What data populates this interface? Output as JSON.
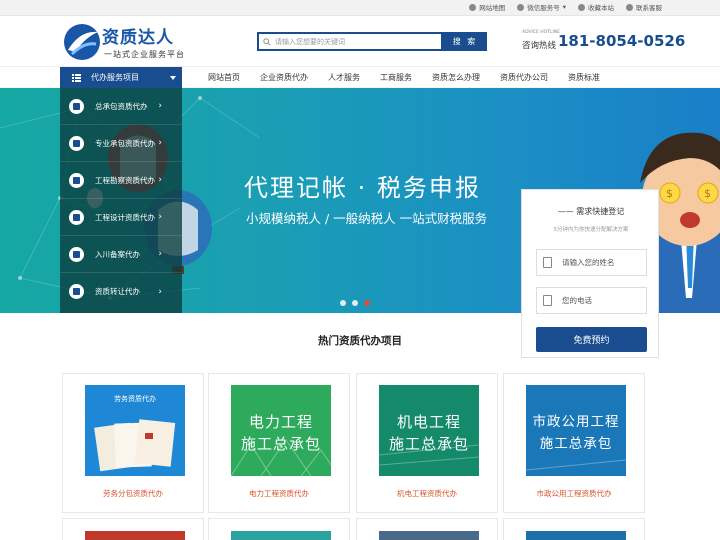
{
  "topbar": {
    "links": [
      "网站地图",
      "微信服务号",
      "收藏本站",
      "联系客服"
    ]
  },
  "header": {
    "logo_name": "资质达人",
    "logo_slogan": "一站式企业服务平台",
    "search_placeholder": "请输入您想要的关键词",
    "search_button": "搜 索",
    "hotline_en": "ADVICE HOTLINE",
    "hotline_label": "咨询热线",
    "hotline_number": "181-8054-0526"
  },
  "nav": {
    "category_label": "代办服务项目",
    "items": [
      "网站首页",
      "企业资质代办",
      "人才服务",
      "工商服务",
      "资质怎么办理",
      "资质代办公司",
      "资质标准"
    ]
  },
  "sidemenu": {
    "items": [
      "总承包资质代办",
      "专业承包资质代办",
      "工程勘察资质代办",
      "工程设计资质代办",
      "入川备案代办",
      "资质转让代办"
    ]
  },
  "banner": {
    "headline": "代理记帐 · 税务申报",
    "subline": "小规模纳税人 / 一般纳税人   一站式财税服务",
    "slides": 3,
    "active_slide": 2
  },
  "register": {
    "title": "—— 需求快捷登记",
    "subtitle": "5分钟内为你快速分配解决方案",
    "name_placeholder": "请输入您的姓名",
    "phone_placeholder": "您的电话",
    "submit": "免费预约"
  },
  "section": {
    "title": "热门资质代办项目",
    "cards": [
      {
        "caption": "劳务分包资质代办",
        "overlay": "",
        "color": "#1e88d6",
        "mini_title": "劳务资质代办"
      },
      {
        "caption": "电力工程资质代办",
        "overlay": "电力工程\n施工总承包",
        "color": "#2eaa5c",
        "mini_title": ""
      },
      {
        "caption": "机电工程资质代办",
        "overlay": "机电工程\n施工总承包",
        "color": "#148a6a",
        "mini_title": ""
      },
      {
        "caption": "市政公用工程资质代办",
        "overlay": "市政公用工程\n施工总承包",
        "color": "#1b78b8",
        "mini_title": ""
      }
    ]
  },
  "colors": {
    "brand": "#1a4d8f",
    "accent": "#d9542b",
    "banner_start": "#15a8a2",
    "banner_end": "#1a7fc8"
  }
}
